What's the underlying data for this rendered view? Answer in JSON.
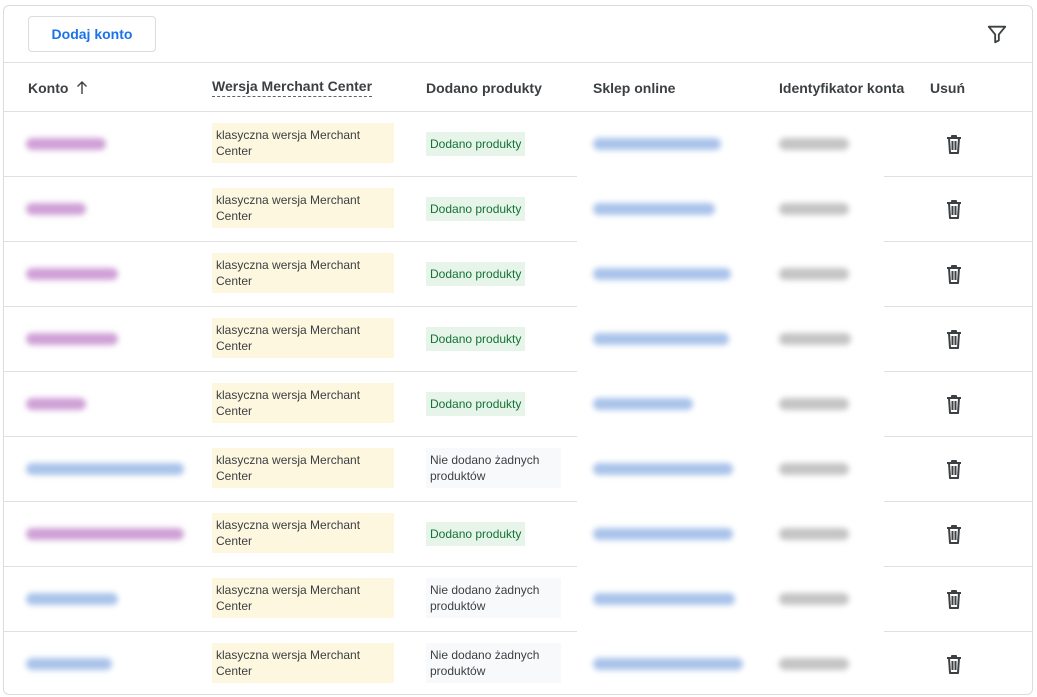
{
  "toolbar": {
    "add_label": "Dodaj konto"
  },
  "columns": {
    "account": "Konto",
    "version": "Wersja Merchant Center",
    "products": "Dodano produkty",
    "store": "Sklep online",
    "id": "Identyfikator konta",
    "delete": "Usuń"
  },
  "rows": [
    {
      "version": "klasyczna wersja Merchant Center",
      "status": "Dodano produkty",
      "status_type": "ok",
      "name_color": "purple",
      "name_w": 80,
      "link_w": 128,
      "id_w": 70
    },
    {
      "version": "klasyczna wersja Merchant Center",
      "status": "Dodano produkty",
      "status_type": "ok",
      "name_color": "purple",
      "name_w": 60,
      "link_w": 122,
      "id_w": 70
    },
    {
      "version": "klasyczna wersja Merchant Center",
      "status": "Dodano produkty",
      "status_type": "ok",
      "name_color": "purple",
      "name_w": 92,
      "link_w": 138,
      "id_w": 70
    },
    {
      "version": "klasyczna wersja Merchant Center",
      "status": "Dodano produkty",
      "status_type": "ok",
      "name_color": "purple",
      "name_w": 92,
      "link_w": 136,
      "id_w": 72
    },
    {
      "version": "klasyczna wersja Merchant Center",
      "status": "Dodano produkty",
      "status_type": "ok",
      "name_color": "purple",
      "name_w": 60,
      "link_w": 100,
      "id_w": 70
    },
    {
      "version": "klasyczna wersja Merchant Center",
      "status": "Nie dodano żadnych produktów",
      "status_type": "no",
      "name_color": "blue",
      "name_w": 158,
      "link_w": 140,
      "id_w": 70
    },
    {
      "version": "klasyczna wersja Merchant Center",
      "status": "Dodano produkty",
      "status_type": "ok",
      "name_color": "purple",
      "name_w": 158,
      "link_w": 140,
      "id_w": 70
    },
    {
      "version": "klasyczna wersja Merchant Center",
      "status": "Nie dodano żadnych produktów",
      "status_type": "no",
      "name_color": "blue",
      "name_w": 92,
      "link_w": 142,
      "id_w": 70
    },
    {
      "version": "klasyczna wersja Merchant Center",
      "status": "Nie dodano żadnych produktów",
      "status_type": "no",
      "name_color": "blue",
      "name_w": 86,
      "link_w": 150,
      "id_w": 70
    }
  ],
  "colors": {
    "accent": "#1a73e8",
    "ok_bg": "#e6f4ea",
    "ok_text": "#137333",
    "version_bg": "#fef7e0"
  },
  "icons": {
    "filter": "filter-icon",
    "sort": "arrow-up-icon",
    "delete": "trash-icon"
  }
}
